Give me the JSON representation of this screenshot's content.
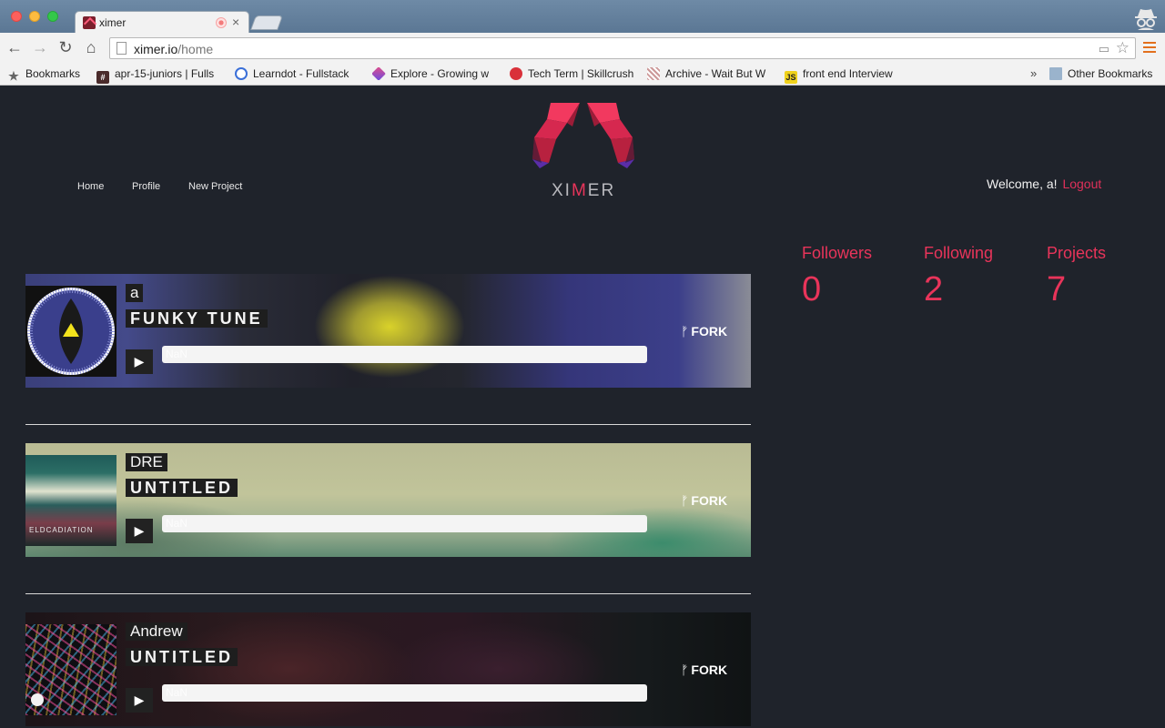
{
  "browser": {
    "tab_title": "ximer",
    "url_host": "ximer.io",
    "url_path": "/home",
    "bookmarks": [
      {
        "label": "Bookmarks"
      },
      {
        "label": "apr-15-juniors | Fulls"
      },
      {
        "label": "Learndot - Fullstack"
      },
      {
        "label": "Explore - Growing w"
      },
      {
        "label": "Tech Term | Skillcrush"
      },
      {
        "label": "Archive - Wait But W"
      },
      {
        "label": "front end Interview"
      }
    ],
    "overflow_label": "»",
    "other_bookmarks": "Other Bookmarks"
  },
  "nav": {
    "home": "Home",
    "profile": "Profile",
    "new_project": "New Project"
  },
  "brand": {
    "part1": "XI",
    "part2": "M",
    "part3": "ER",
    "accent_color": "#e8345a"
  },
  "user": {
    "welcome": "Welcome, a!",
    "logout": "Logout"
  },
  "stats": [
    {
      "label": "Followers",
      "value": "0"
    },
    {
      "label": "Following",
      "value": "2"
    },
    {
      "label": "Projects",
      "value": "7"
    }
  ],
  "projects": [
    {
      "author": "a",
      "title": "FUNKY TUNE",
      "progress_text": "NaN",
      "fork_label": "FORK"
    },
    {
      "author": "DRE",
      "title": "UNTITLED",
      "progress_text": "NaN",
      "fork_label": "FORK",
      "cover_text": "ELDCADIATION"
    },
    {
      "author": "Andrew",
      "title": "UNTITLED",
      "progress_text": "NaN",
      "fork_label": "FORK"
    }
  ]
}
